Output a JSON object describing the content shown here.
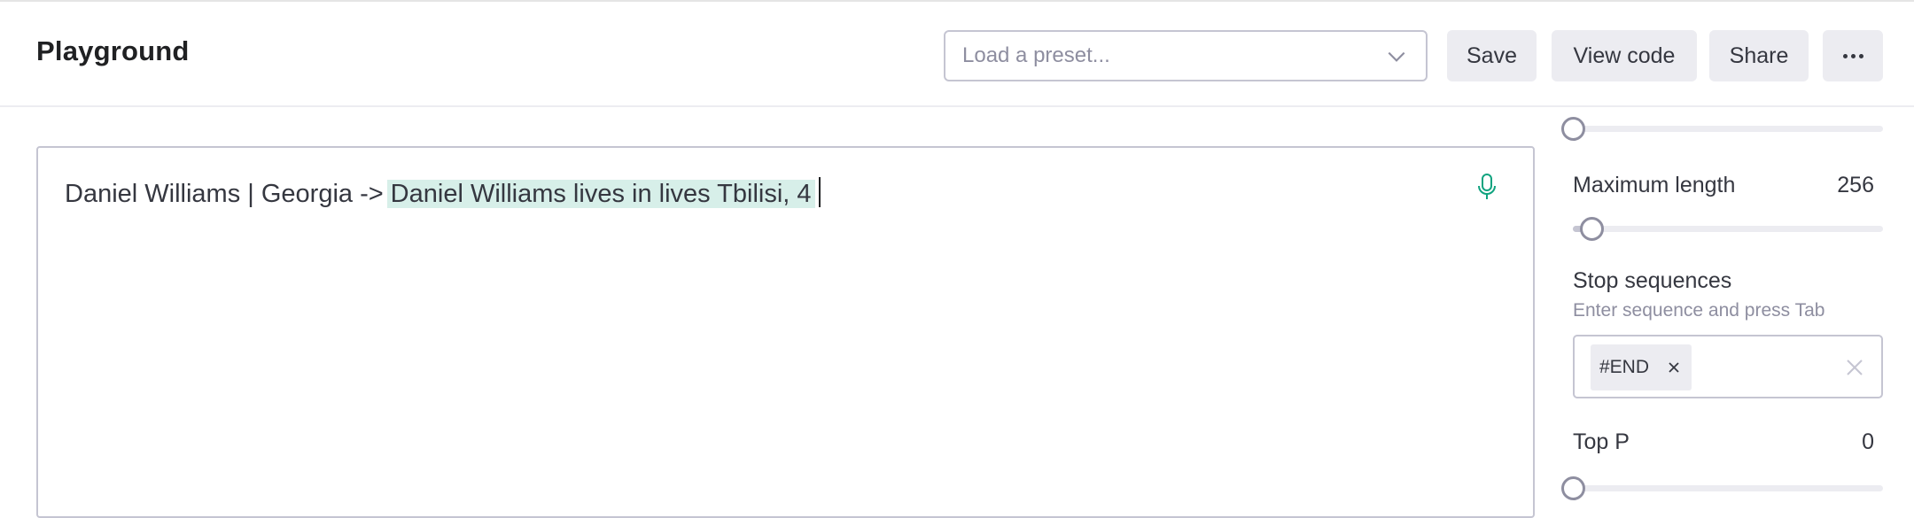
{
  "header": {
    "title": "Playground",
    "preset_placeholder": "Load a preset...",
    "buttons": {
      "save": "Save",
      "view_code": "View code",
      "share": "Share"
    }
  },
  "editor": {
    "prompt": "Daniel Williams | Georgia ->",
    "completion": "Daniel Williams lives in lives Tbilisi, 4"
  },
  "settings": {
    "top_slider_fraction": 0.0,
    "max_length": {
      "label": "Maximum length",
      "value": "256",
      "fraction": 0.06
    },
    "stop_sequences": {
      "label": "Stop sequences",
      "hint": "Enter sequence and press Tab",
      "chips": [
        "#END"
      ]
    },
    "top_p": {
      "label": "Top P",
      "value": "0",
      "fraction": 0.0
    }
  },
  "colors": {
    "accent": "#10a37f",
    "completion_highlight": "#d2f4d3",
    "border": "#c5c5d2",
    "button_bg": "#ececf1"
  }
}
